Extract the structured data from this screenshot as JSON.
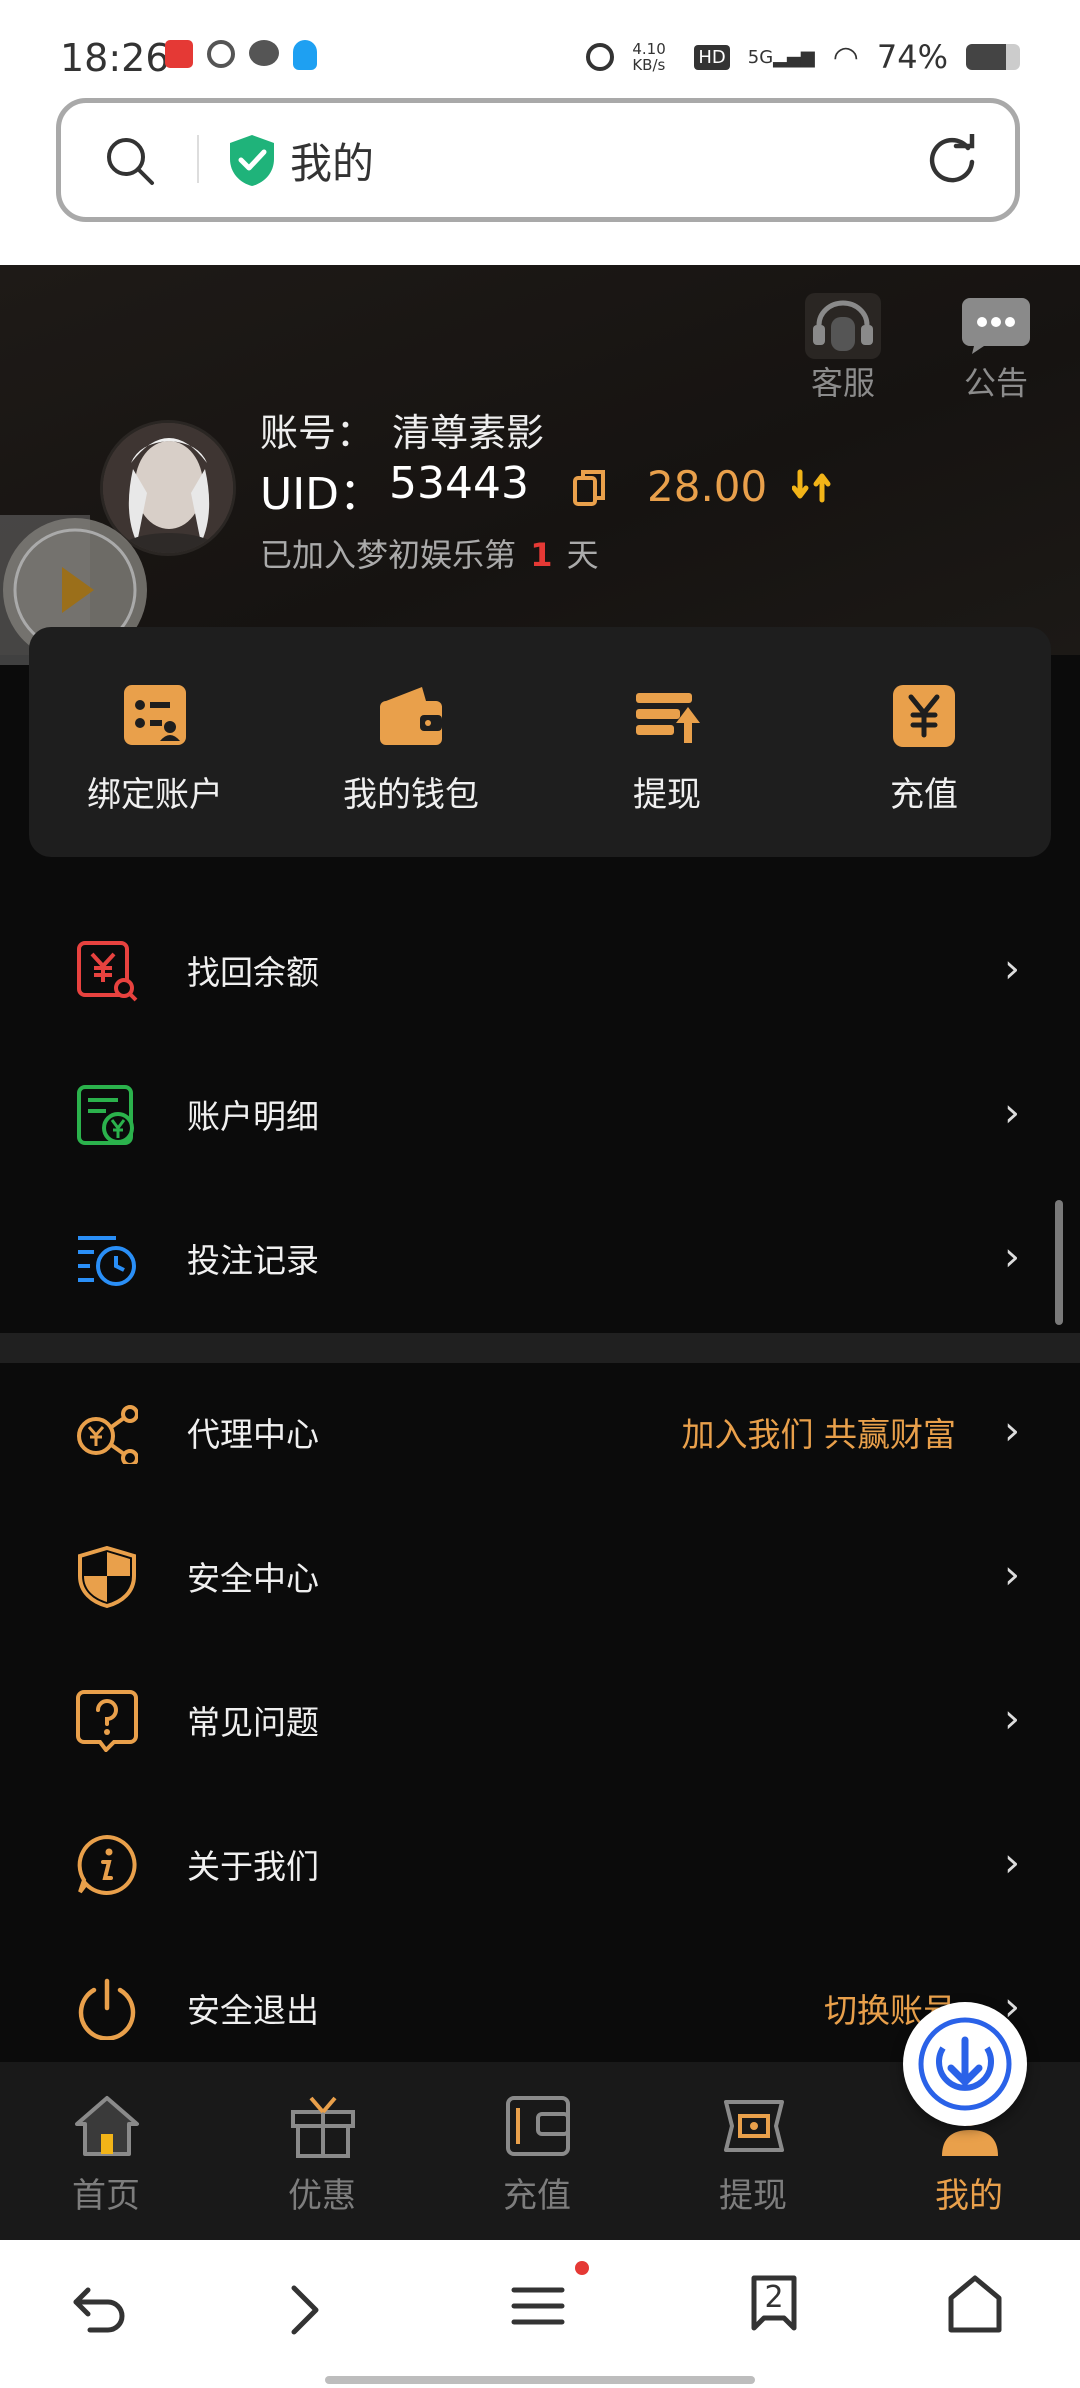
{
  "status_bar": {
    "time": "18:26",
    "net_speed": "4.10 KB/s",
    "hd": "HD",
    "signal": "5G",
    "battery": "74%"
  },
  "url_bar": {
    "title": "我的"
  },
  "header": {
    "service_label": "客服",
    "notice_label": "公告",
    "account_label": "账号：",
    "account_name": "清尊素影",
    "uid_label": "UID：",
    "uid_value": "53443",
    "balance": "28.00",
    "joined_prefix": "已加入梦初娱乐第",
    "joined_days": "1",
    "joined_suffix": "天"
  },
  "quick_actions": [
    {
      "label": "绑定账户",
      "icon": "bind-account-icon"
    },
    {
      "label": "我的钱包",
      "icon": "wallet-icon"
    },
    {
      "label": "提现",
      "icon": "withdraw-icon"
    },
    {
      "label": "充值",
      "icon": "recharge-icon"
    }
  ],
  "menu_group1": [
    {
      "label": "找回余额",
      "icon": "recover-balance-icon",
      "color": "#e8423f"
    },
    {
      "label": "账户明细",
      "icon": "account-details-icon",
      "color": "#2bb24c"
    },
    {
      "label": "投注记录",
      "icon": "bet-record-icon",
      "color": "#2a8ff7"
    }
  ],
  "menu_group2": [
    {
      "label": "代理中心",
      "sub": "加入我们 共赢财富",
      "icon": "agent-icon"
    },
    {
      "label": "安全中心",
      "sub": "",
      "icon": "security-shield-icon"
    },
    {
      "label": "常见问题",
      "sub": "",
      "icon": "faq-icon"
    },
    {
      "label": "关于我们",
      "sub": "",
      "icon": "info-icon"
    },
    {
      "label": "安全退出",
      "sub": "切换账号",
      "icon": "power-icon"
    }
  ],
  "tabs": [
    {
      "label": "首页",
      "icon": "home-icon"
    },
    {
      "label": "优惠",
      "icon": "gift-icon"
    },
    {
      "label": "充值",
      "icon": "recharge-tab-icon"
    },
    {
      "label": "提现",
      "icon": "withdraw-tab-icon"
    },
    {
      "label": "我的",
      "icon": "profile-icon",
      "active": true
    }
  ],
  "browser_nav": {
    "tab_count": "2"
  },
  "colors": {
    "accent": "#e9a04b",
    "bg": "#0b0b0b",
    "card": "#1e1e1e",
    "tabbar": "#191919"
  }
}
